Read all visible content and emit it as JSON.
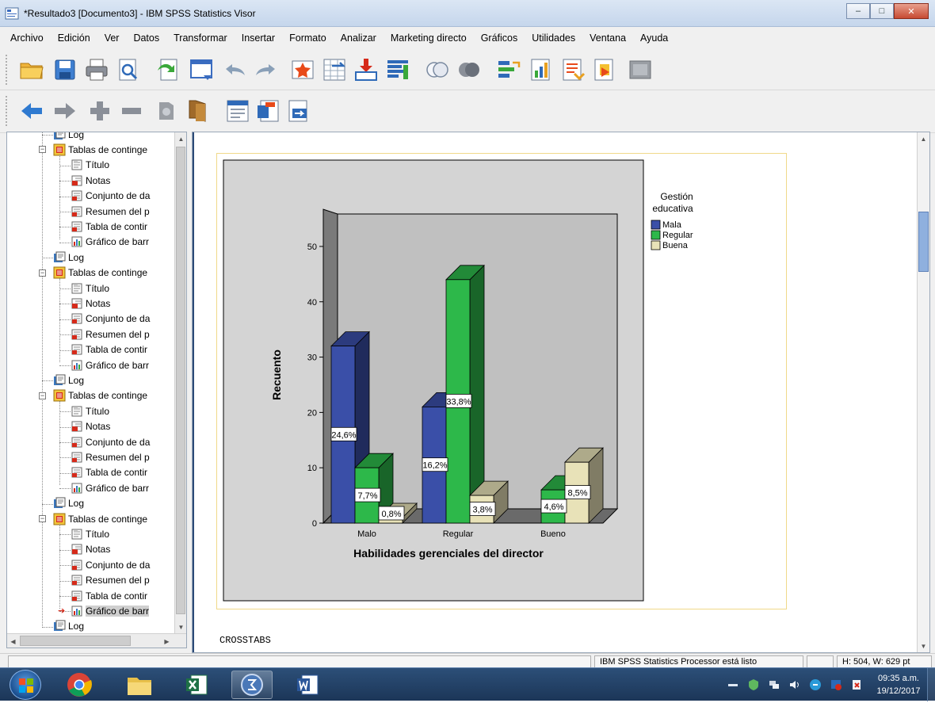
{
  "window": {
    "title": "*Resultado3 [Documento3] - IBM SPSS Statistics Visor",
    "minimize_glyph": "–",
    "maximize_glyph": "□",
    "close_glyph": "✕"
  },
  "menubar": {
    "items": [
      "Archivo",
      "Edición",
      "Ver",
      "Datos",
      "Transformar",
      "Insertar",
      "Formato",
      "Analizar",
      "Marketing directo",
      "Gráficos",
      "Utilidades",
      "Ventana",
      "Ayuda"
    ]
  },
  "toolbar1": {
    "icons": [
      "open-folder-icon",
      "save-icon",
      "print-icon",
      "print-preview-icon",
      "export-icon",
      "recall-dialog-icon",
      "undo-icon",
      "redo-icon",
      "goto-data-icon",
      "goto-case-icon",
      "goto-variable-icon",
      "variables-icon",
      "use-variable-sets-icon",
      "show-all-variables-icon",
      "split-file-icon",
      "weight-cases-icon",
      "select-cases-icon",
      "value-labels-icon",
      "designate-window-icon"
    ]
  },
  "toolbar2": {
    "icons": [
      "promote-icon",
      "demote-icon",
      "expand-icon",
      "collapse-icon",
      "show-icon",
      "hide-icon",
      "insert-heading-icon",
      "insert-title-icon",
      "insert-text-icon"
    ]
  },
  "tree": {
    "log_label": "Log",
    "group_label": "Tablas de continge",
    "children": [
      "Título",
      "Notas",
      "Conjunto de da",
      "Resumen del p",
      "Tabla de contir",
      "Gráfico de barr"
    ]
  },
  "chart_data": {
    "type": "bar",
    "title": "",
    "xlabel": "Habilidades gerenciales del director",
    "ylabel": "Recuento",
    "categories": [
      "Malo",
      "Regular",
      "Bueno"
    ],
    "ylim": [
      0,
      53
    ],
    "yticks": [
      0,
      10,
      20,
      30,
      40,
      50
    ],
    "legend_title": "Gestión educativa",
    "legend_placement": "right",
    "series": [
      {
        "name": "Mala",
        "color": "#3a4fa8",
        "values": [
          32,
          21,
          0
        ],
        "labels": [
          "24,6%",
          "16,2%",
          ""
        ]
      },
      {
        "name": "Regular",
        "color": "#2db84a",
        "values": [
          10,
          44,
          6
        ],
        "labels": [
          "7,7%",
          "33,8%",
          "4,6%"
        ]
      },
      {
        "name": "Buena",
        "color": "#e8e2b8",
        "values": [
          1,
          5,
          11
        ],
        "labels": [
          "0,8%",
          "3,8%",
          "8,5%"
        ]
      }
    ]
  },
  "content": {
    "syntax_text": "CROSSTABS"
  },
  "status": {
    "processor": "IBM SPSS Statistics Processor está listo",
    "dimensions": "H: 504, W: 629 pt"
  },
  "taskbar": {
    "apps": [
      "start-button",
      "chrome-app",
      "file-explorer-app",
      "excel-app",
      "spss-app",
      "word-app"
    ],
    "time": "09:35 a.m.",
    "date": "19/12/2017"
  }
}
